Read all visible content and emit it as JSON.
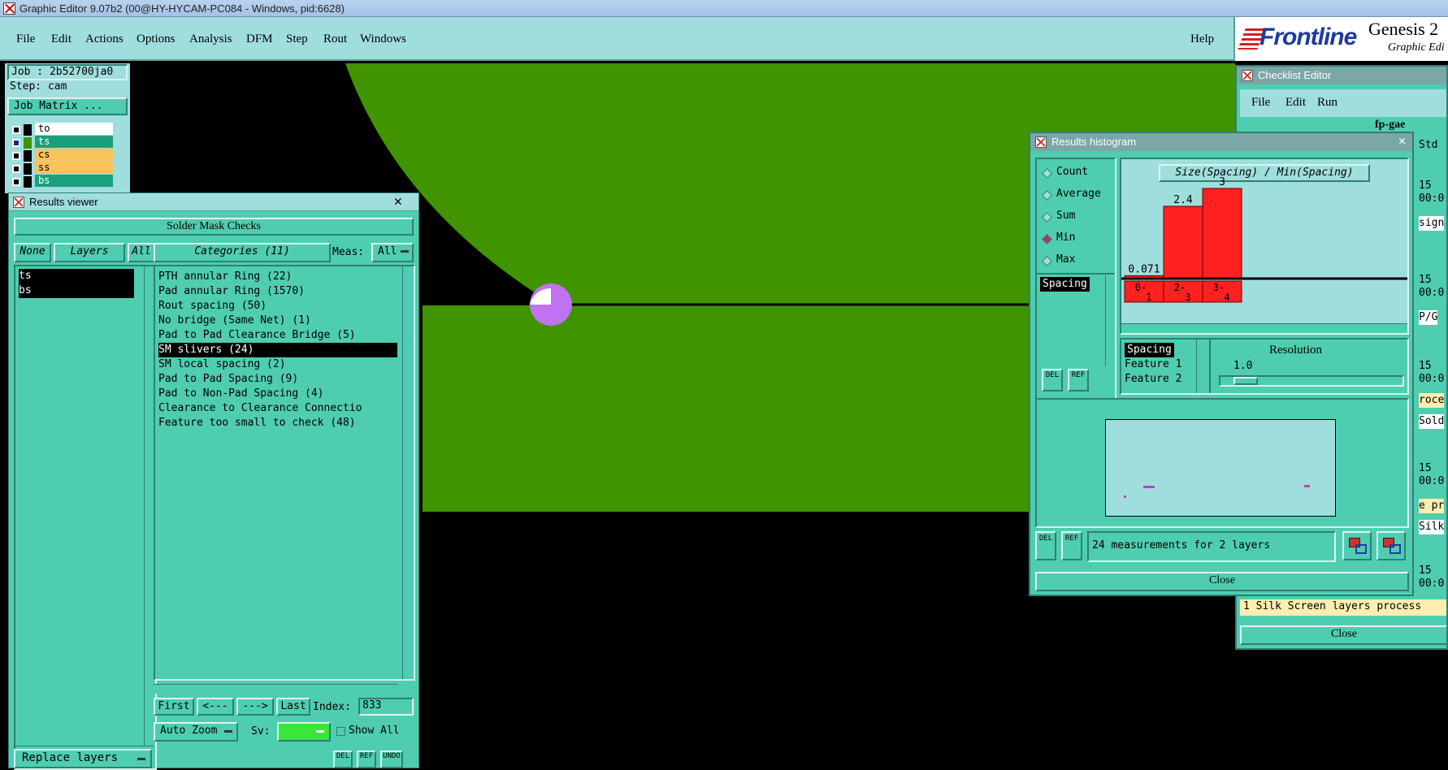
{
  "window": {
    "title": "Graphic Editor 9.07b2 (00@HY-HYCAM-PC084 - Windows, pid:6628)"
  },
  "menu": {
    "items": [
      "File",
      "Edit",
      "Actions",
      "Options",
      "Analysis",
      "DFM",
      "Step",
      "Rout",
      "Windows"
    ],
    "help": "Help"
  },
  "branding": {
    "logo": "Frontline",
    "product": "Genesis 2",
    "subtitle": "Graphic Edi"
  },
  "job": {
    "job_label": "Job : 2b52700ja0",
    "step_label": "Step: cam",
    "matrix_button": "Job Matrix ..."
  },
  "layers_list": [
    {
      "name": "to",
      "color": "#ffffff"
    },
    {
      "name": "ts",
      "color": "#1aa07a"
    },
    {
      "name": "cs",
      "color": "#f7c35a"
    },
    {
      "name": "ss",
      "color": "#f7c35a"
    },
    {
      "name": "bs",
      "color": "#1aa07a"
    }
  ],
  "results_viewer": {
    "title": "Results viewer",
    "header": "Solder Mask Checks",
    "none_btn": "None",
    "layers_btn": "Layers",
    "all_btn": "All",
    "categories_btn": "Categories (11)",
    "meas_label": "Meas:",
    "meas_value": "All",
    "layers": [
      "ts",
      "bs"
    ],
    "categories": [
      "PTH annular Ring (22)",
      "Pad annular Ring (1570)",
      "Rout spacing (50)",
      "No bridge (Same Net) (1)",
      "Pad to Pad Clearance Bridge (5)",
      "SM slivers (24)",
      "SM local spacing (2)",
      "Pad to Pad Spacing (9)",
      "Pad to Non-Pad Spacing (4)",
      "Clearance to Clearance Connectio",
      "Feature too small to check (48)"
    ],
    "selected_category": 5,
    "first_btn": "First",
    "prev_btn": "<---",
    "next_btn": "--->",
    "last_btn": "Last",
    "index_label": "Index:",
    "index_value": "833",
    "autozoom": "Auto Zoom",
    "sv_label": "Sv:",
    "show_all": "Show All",
    "replace_layers": "Replace layers",
    "del": "DEL",
    "ref": "REF",
    "undo": "UNDO"
  },
  "histogram": {
    "title": "Results histogram",
    "modes": [
      "Count",
      "Average",
      "Sum",
      "Min",
      "Max"
    ],
    "selected_mode": "Min",
    "metric": "Spacing",
    "formula": "Size(Spacing) / Min(Spacing)",
    "resolution_label": "Resolution",
    "resolution_value": "1.0",
    "fields": [
      "Spacing",
      "Feature 1",
      "Feature 2"
    ],
    "status": "24 measurements for 2 layers",
    "close": "Close",
    "del": "DEL",
    "ref": "REF"
  },
  "chart_data": {
    "type": "bar",
    "categories": [
      "0-1",
      "2-3",
      "3-4"
    ],
    "values": [
      0.071,
      2.4,
      3
    ],
    "ylim": [
      0,
      3
    ]
  },
  "checklist": {
    "title": "Checklist Editor",
    "menu": [
      "File",
      "Edit",
      "Run"
    ],
    "name": "fp-gae",
    "right_text": [
      "Std",
      "15",
      "00:0",
      "sign",
      "15",
      "00:0",
      "P/G",
      "15",
      "00:0",
      "roce",
      "Sold",
      "15",
      "00:0",
      "e pr",
      "Silk",
      "15",
      "00:0"
    ],
    "status": "1 Silk Screen layers process",
    "close": "Close"
  },
  "colors": {
    "green": "#3f9400",
    "teal": "#4fcdb0",
    "light": "#a0dede",
    "highlight": "#c073f0"
  }
}
